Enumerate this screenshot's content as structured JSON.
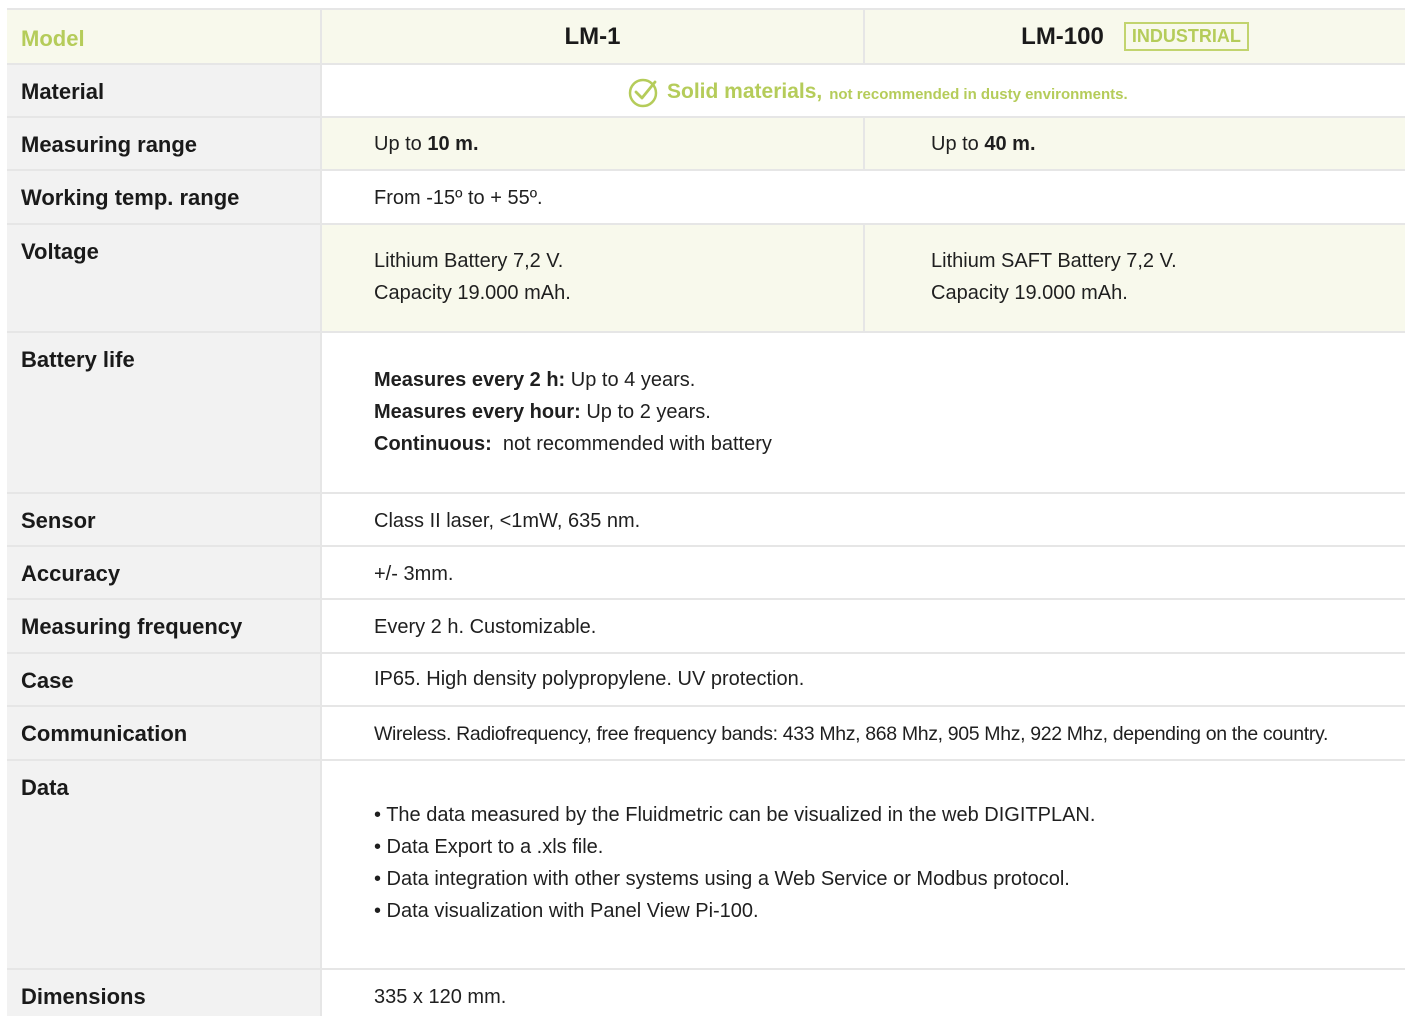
{
  "header": {
    "model_label": "Model",
    "col1": "LM-1",
    "col2": "LM-100",
    "badge": "INDUSTRIAL"
  },
  "material": {
    "label": "Material",
    "bold": "Solid materials,",
    "note": "not recommended in dusty environments."
  },
  "measuring_range": {
    "label": "Measuring range",
    "c1_prefix": "Up to",
    "c1_value": "10 m.",
    "c2_prefix": "Up to",
    "c2_value": "40 m."
  },
  "working_temp": {
    "label": "Working temp. range",
    "value": "From -15º to + 55º."
  },
  "voltage": {
    "label": "Voltage",
    "c1_line1": "Lithium Battery 7,2 V.",
    "c1_line2": "Capacity 19.000 mAh.",
    "c2_line1": "Lithium SAFT Battery 7,2 V.",
    "c2_line2": "Capacity 19.000 mAh."
  },
  "battery_life": {
    "label": "Battery life",
    "items": [
      {
        "bold": "Measures every 2 h:",
        "text": "Up to 4 years."
      },
      {
        "bold": "Measures every hour:",
        "text": "Up to 2 years."
      },
      {
        "bold": "Continuous:",
        "text": "not recommended with battery"
      }
    ]
  },
  "sensor": {
    "label": "Sensor",
    "value": "Class II laser, <1mW, 635 nm."
  },
  "accuracy": {
    "label": "Accuracy",
    "value": "+/- 3mm."
  },
  "frequency": {
    "label": "Measuring frequency",
    "value": "Every 2 h. Customizable."
  },
  "case": {
    "label": "Case",
    "value": "IP65. High density polypropylene. UV protection."
  },
  "communication": {
    "label": "Communication",
    "value": "Wireless. Radiofrequency, free frequency bands: 433 Mhz, 868 Mhz, 905 Mhz, 922 Mhz, depending on the country."
  },
  "data": {
    "label": "Data",
    "items": [
      "• The data measured by the Fluidmetric can be visualized in the web DIGITPLAN.",
      "• Data Export to a .xls file.",
      "• Data integration with other systems using a Web Service or Modbus protocol.",
      "• Data visualization with Panel View Pi-100."
    ]
  },
  "dimensions": {
    "label": "Dimensions",
    "value": "335 x 120 mm."
  },
  "colors": {
    "accent": "#b5cc5a",
    "tint": "#f8f9ec",
    "label_bg": "#f2f2f2"
  },
  "icons": {
    "material": "check-circle-icon"
  }
}
